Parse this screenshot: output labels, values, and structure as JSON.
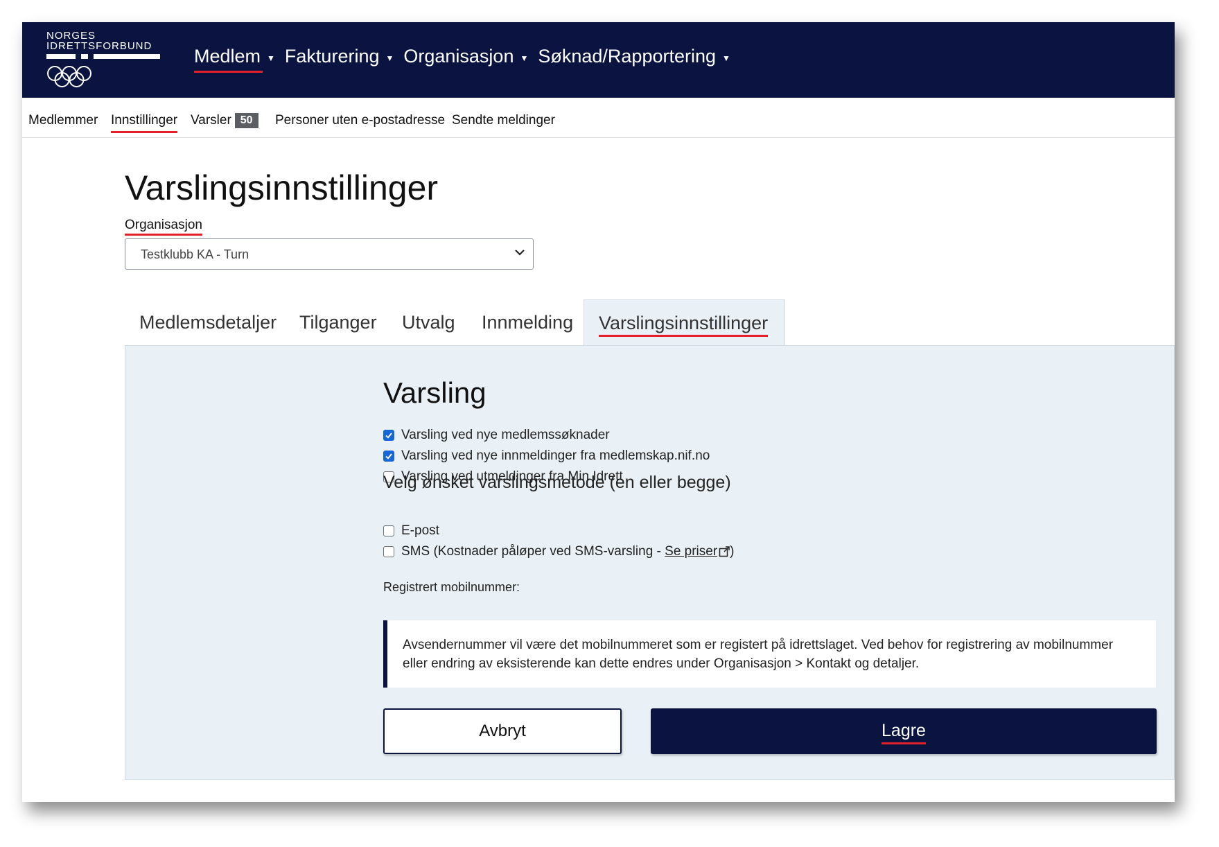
{
  "logo": {
    "line1": "NORGES",
    "line2": "IDRETTSFORBUND"
  },
  "main_nav": [
    {
      "label": "Medlem",
      "active": true
    },
    {
      "label": "Fakturering"
    },
    {
      "label": "Organisasjon"
    },
    {
      "label": "Søknad/Rapportering"
    }
  ],
  "sub_nav": {
    "members": "Medlemmer",
    "settings": "Innstillinger",
    "alerts": "Varsler",
    "alerts_count": "50",
    "no_email": "Personer uten e-postadresse",
    "sent_messages": "Sendte meldinger"
  },
  "page": {
    "title": "Varslingsinnstillinger",
    "org_label": "Organisasjon",
    "org_selected": "Testklubb KA - Turn"
  },
  "tabs": [
    {
      "label": "Medlemsdetaljer"
    },
    {
      "label": "Tilganger"
    },
    {
      "label": "Utvalg"
    },
    {
      "label": "Innmelding"
    },
    {
      "label": "Varslingsinnstillinger",
      "active": true
    }
  ],
  "panel": {
    "heading": "Varsling",
    "notify_options": [
      {
        "label": "Varsling ved nye medlemssøknader",
        "checked": true
      },
      {
        "label": "Varsling ved nye innmeldinger fra medlemskap.nif.no",
        "checked": true
      },
      {
        "label": "Varsling ved utmeldinger fra Min Idrett",
        "checked": false
      }
    ],
    "method_heading": "Velg ønsket varslingsmetode (en eller begge)",
    "email_label": "E-post",
    "email_checked": false,
    "sms_label_prefix": "SMS (Kostnader påløper ved SMS-varsling - ",
    "sms_link": "Se priser",
    "sms_label_suffix": ")",
    "sms_checked": false,
    "mobile_label": "Registrert mobilnummer:",
    "info_text": "Avsendernummer vil være det mobilnummeret som er registert på idrettslaget. Ved behov for registrering av mobilnummer eller endring av eksisterende kan dette endres under Organisasjon > Kontakt og detaljer.",
    "cancel_label": "Avbryt",
    "save_label": "Lagre"
  },
  "colors": {
    "brand_navy": "#0b1440",
    "accent_red": "#e3202a",
    "panel_bg": "#e9f1f6",
    "checkbox_blue": "#1766d6"
  }
}
